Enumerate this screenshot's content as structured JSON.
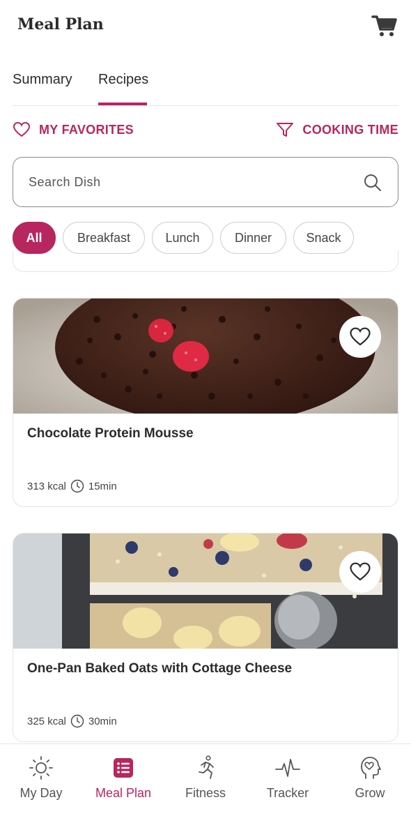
{
  "header": {
    "title": "Meal Plan"
  },
  "tabs": [
    {
      "label": "Summary"
    },
    {
      "label": "Recipes"
    }
  ],
  "filters": {
    "favorites": "MY FAVORITES",
    "cooking_time": "COOKING TIME"
  },
  "search": {
    "placeholder": "Search Dish"
  },
  "categories": [
    {
      "label": "All",
      "active": true
    },
    {
      "label": "Breakfast"
    },
    {
      "label": "Lunch"
    },
    {
      "label": "Dinner"
    },
    {
      "label": "Snack"
    }
  ],
  "recipes": [
    {
      "title": "Chocolate Protein Mousse",
      "kcal": "313 kcal",
      "time": "15min"
    },
    {
      "title": "One-Pan Baked Oats with Cottage Cheese",
      "kcal": "325 kcal",
      "time": "30min"
    }
  ],
  "nav": [
    {
      "label": "My Day",
      "icon": "sun-icon"
    },
    {
      "label": "Meal Plan",
      "icon": "menu-list-icon",
      "active": true
    },
    {
      "label": "Fitness",
      "icon": "running-icon"
    },
    {
      "label": "Tracker",
      "icon": "pulse-icon"
    },
    {
      "label": "Grow",
      "icon": "head-heart-icon"
    }
  ],
  "colors": {
    "accent": "#b8265e",
    "text": "#2b2b2b",
    "border": "#e4e4e4"
  }
}
